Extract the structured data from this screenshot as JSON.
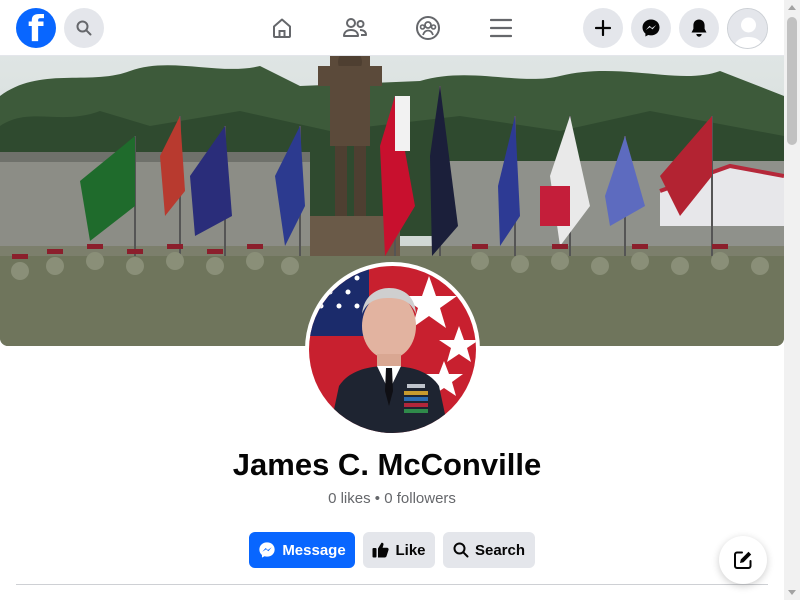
{
  "profile": {
    "name": "James C. McConville",
    "likes": "0 likes",
    "separator": "•",
    "followers": "0 followers"
  },
  "actions": {
    "message_label": "Message",
    "like_label": "Like",
    "search_label": "Search"
  },
  "icons": {
    "logo": "facebook-logo",
    "search": "search-icon",
    "home": "home-icon",
    "friends": "friends-icon",
    "groups": "groups-icon",
    "menu": "menu-icon",
    "create": "plus-icon",
    "messenger": "messenger-icon",
    "notifications": "bell-icon",
    "compose": "compose-icon"
  },
  "colors": {
    "brand": "#0866ff",
    "button_grey": "#e4e6eb",
    "text_primary": "#050505",
    "text_secondary": "#65676b"
  }
}
